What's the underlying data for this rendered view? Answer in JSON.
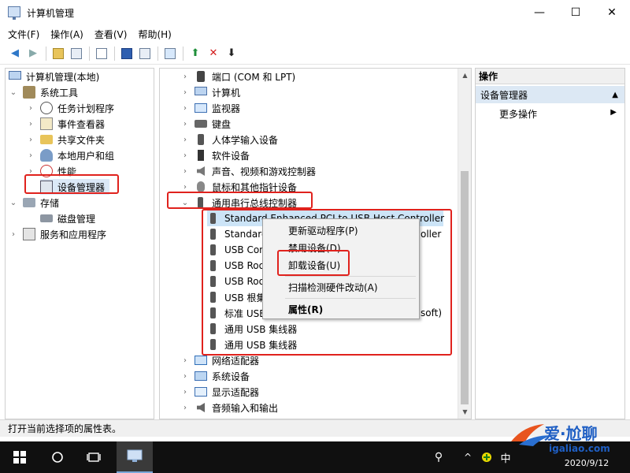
{
  "window": {
    "title": "计算机管理",
    "minimize": "—",
    "maximize": "☐",
    "close": "✕"
  },
  "menu": [
    "文件(F)",
    "操作(A)",
    "查看(V)",
    "帮助(H)"
  ],
  "left_tree": {
    "root": "计算机管理(本地)",
    "system_tools": "系统工具",
    "task_scheduler": "任务计划程序",
    "event_viewer": "事件查看器",
    "shared_folders": "共享文件夹",
    "local_users": "本地用户和组",
    "performance": "性能",
    "device_manager": "设备管理器",
    "storage": "存储",
    "disk_management": "磁盘管理",
    "services_apps": "服务和应用程序"
  },
  "device_tree": {
    "ports": "端口 (COM 和 LPT)",
    "computer": "计算机",
    "monitors": "监视器",
    "keyboards": "键盘",
    "hid": "人体学输入设备",
    "software_devices": "软件设备",
    "sound": "声音、视频和游戏控制器",
    "mice": "鼠标和其他指针设备",
    "usb_controllers": "通用串行总线控制器",
    "usb_children": [
      "Standard Enhanced PCI to USB Host Controller",
      "Standard",
      "USB Con",
      "USB Roo",
      "USB Roo",
      "USB 根集",
      "标准 USB",
      "通用 USB 集线器",
      "通用 USB 集线器"
    ],
    "usb_children_tail": [
      "",
      "oller",
      "",
      "",
      "",
      "",
      "soft)",
      "",
      ""
    ],
    "network_adapters": "网络适配器",
    "system_devices": "系统设备",
    "display_adapters": "显示适配器",
    "audio_io": "音频输入和输出"
  },
  "context_menu": {
    "update_driver": "更新驱动程序(P)",
    "disable_device": "禁用设备(D)",
    "uninstall_device": "卸载设备(U)",
    "scan_hardware": "扫描检测硬件改动(A)",
    "properties": "属性(R)"
  },
  "actions_pane": {
    "header": "操作",
    "section": "设备管理器",
    "more_actions": "更多操作"
  },
  "status_bar": "打开当前选择项的属性表。",
  "taskbar": {
    "ime": "中",
    "date": "2020/9/12"
  },
  "watermark": {
    "brand": "爱·尬聊",
    "url": "igaliao.com"
  },
  "colors": {
    "highlight_red": "#e0221d",
    "selection_blue": "#cce4f7"
  }
}
